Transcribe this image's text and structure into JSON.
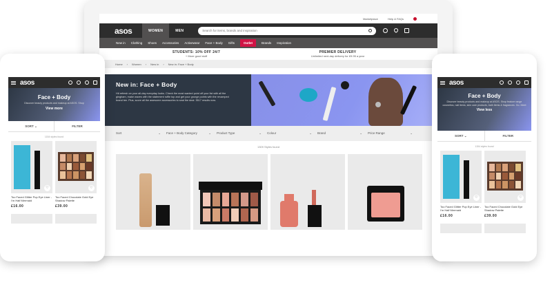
{
  "colors": {
    "header_bg": "#2d2d2d",
    "nav_bg": "#525050",
    "outlet": "#d01345",
    "hero_dark": "#2d3744",
    "hero_blue": "#8a95f0"
  },
  "desktop": {
    "utility_links": [
      "Marketplace",
      "Help & FAQs"
    ],
    "logo": "asos",
    "gender_tabs": [
      "WOMEN",
      "MEN"
    ],
    "search_placeholder": "Search for items, brands and inspiration",
    "category_nav": [
      "New in",
      "Clothing",
      "Shoes",
      "Accessories",
      "Activewear",
      "Face + Body",
      "Gifts",
      "Outlet",
      "Brands",
      "Inspiration"
    ],
    "promo": [
      {
        "title": "STUDENTS: 10% OFF 24/7",
        "sub": "+ More good stuff"
      },
      {
        "title": "PREMIER DELIVERY",
        "sub": "Unlimited next-day delivery for £9.95 a year"
      }
    ],
    "breadcrumb": [
      "Home",
      "Women",
      "New in",
      "New in: Face + Body"
    ],
    "hero_title": "New in: Face + Body",
    "hero_desc": "Hit refresh on your all-day everyday looks. Check the most wanted point off your list with all the gingham, make waves with the statement ruffle top and get your grunge points with the revamped brand tee. Plus, score all the awesome accessories to seal the deal. 3517 results now.",
    "filters": [
      "Sort",
      "Face + Body Category",
      "Product Type",
      "Colour",
      "Brand",
      "Price Range"
    ],
    "found": "1309 Styles found"
  },
  "mobile_left": {
    "logo": "asos",
    "banner_title": "Face + Body",
    "banner_desc": "Discover beauty products and makeup at ASOS. Shop",
    "view_more": "View more",
    "sort": "SORT",
    "filter": "FILTER",
    "found": "1154 styles found",
    "products": [
      {
        "name": "Too Faced Glitter Pop Eye Liner - I'm Half Mermaid",
        "price": "£16.00"
      },
      {
        "name": "Too Faced Chocolate Gold Eye Shadow Palette",
        "price": "£39.00"
      }
    ]
  },
  "mobile_right": {
    "logo": "asos",
    "banner_title": "Face + Body",
    "banner_desc": "Discover beauty products and makeup at ASOS. Shop feature range cosmetics, nail items, skin care products, bath items & fragrances. Go. Meet",
    "view_more": "View less",
    "sort": "SORT",
    "filter": "FILTER",
    "found": "1154 styles found",
    "products": [
      {
        "name": "Too Faced Glitter Pop Eye Liner - I'm Half Mermaid",
        "price": "£16.00"
      },
      {
        "name": "Too Faced Chocolate Gold Eye Shadow Palette",
        "price": "£39.00"
      }
    ]
  }
}
